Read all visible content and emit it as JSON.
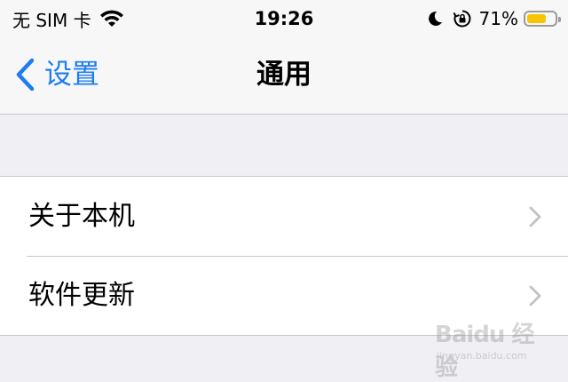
{
  "status_bar": {
    "carrier": "无 SIM 卡",
    "time": "19:26",
    "battery_percent": "71%",
    "battery_level": 0.71,
    "icons": [
      "wifi-icon",
      "moon-icon",
      "rotation-lock-icon",
      "battery-icon"
    ]
  },
  "nav": {
    "back_label": "设置",
    "title": "通用"
  },
  "settings": {
    "items": [
      {
        "label": "关于本机"
      },
      {
        "label": "软件更新"
      }
    ]
  },
  "watermark": {
    "logo": "Baidu 经验",
    "url": "jingyan.baidu.com"
  },
  "colors": {
    "accent": "#1d7cf4",
    "background": "#efeff4",
    "battery": "#f6c400"
  }
}
